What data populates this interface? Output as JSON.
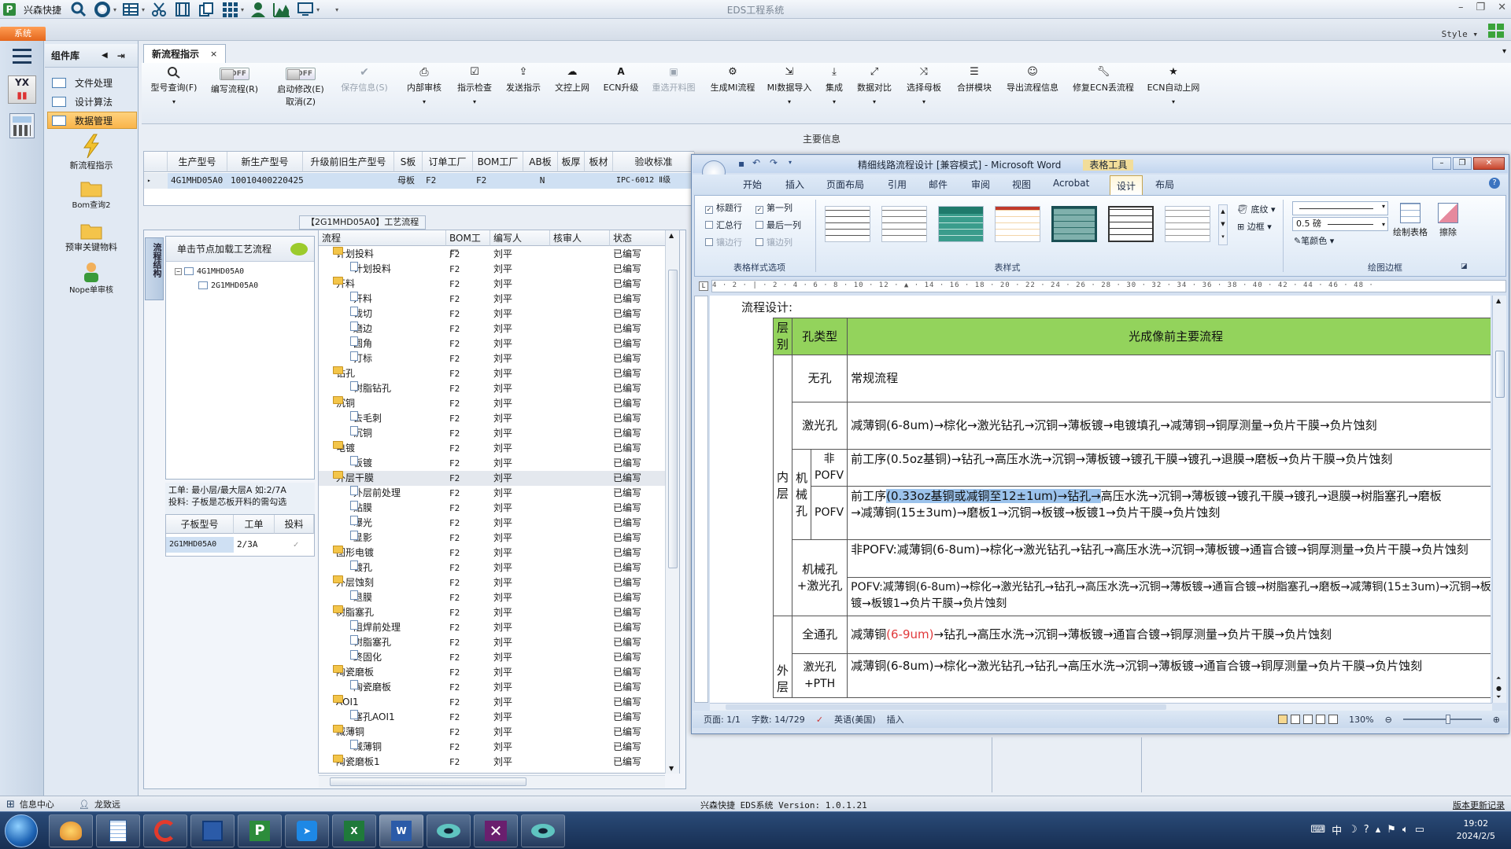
{
  "app": {
    "title": "EDS工程系统",
    "brand": "兴森快捷",
    "style_menu": "Style",
    "system_tab": "系统",
    "accent": "#f47b2a"
  },
  "quick_access": [
    {
      "icon": "search-icon"
    },
    {
      "icon": "lifebuoy-icon"
    },
    {
      "icon": "table-icon"
    },
    {
      "icon": "scissors-icon"
    },
    {
      "icon": "film-icon"
    },
    {
      "icon": "copy-icon"
    },
    {
      "icon": "grid-icon"
    },
    {
      "icon": "user-icon"
    },
    {
      "icon": "area-chart-icon"
    },
    {
      "icon": "monitor-icon"
    }
  ],
  "left_nav": {
    "header": "组件库",
    "items": [
      {
        "label": "文件处理",
        "active": false
      },
      {
        "label": "设计算法",
        "active": false
      },
      {
        "label": "数据管理",
        "active": true
      }
    ],
    "tools": [
      {
        "label": "新流程指示",
        "icon": "lightning-icon"
      },
      {
        "label": "Bom查询2",
        "icon": "folder-icon"
      },
      {
        "label": "预审关键物料",
        "icon": "folder-icon"
      },
      {
        "label": "Nope单审核",
        "icon": "person-icon"
      }
    ]
  },
  "document_tab": {
    "label": "新流程指示"
  },
  "ribbon": [
    {
      "label": "型号查询(F)",
      "icon": "search-icon",
      "disabled": false,
      "dropdown": true
    },
    {
      "label": "编写流程(R)",
      "toggle": "OFF"
    },
    {
      "label": "启动修改(E)",
      "label2": "取消(Z)",
      "toggle": "OFF"
    },
    {
      "label": "保存信息(S)",
      "icon": "check-icon",
      "disabled": true
    },
    {
      "label": "内部审核",
      "icon": "print-icon",
      "dropdown": true
    },
    {
      "label": "指示检查",
      "icon": "checkbox-icon",
      "dropdown": true
    },
    {
      "label": "发送指示",
      "icon": "upload-icon"
    },
    {
      "label": "文控上网",
      "icon": "cloud-upload-icon"
    },
    {
      "label": "ECN升级",
      "icon": "acrobat-icon"
    },
    {
      "label": "重选开料图",
      "icon": "image-icon",
      "disabled": true
    },
    {
      "label": "生成MI流程",
      "icon": "gears-icon"
    },
    {
      "label": "MI数据导入",
      "icon": "import-icon",
      "dropdown": true
    },
    {
      "label": "集成",
      "icon": "download-icon",
      "dropdown": true
    },
    {
      "label": "数据对比",
      "icon": "compare-icon",
      "dropdown": true
    },
    {
      "label": "选择母板",
      "icon": "shuffle-icon",
      "dropdown": true
    },
    {
      "label": "合拼模块",
      "icon": "list-icon"
    },
    {
      "label": "导出流程信息",
      "icon": "smile-icon"
    },
    {
      "label": "修复ECN丢流程",
      "icon": "wrench-icon"
    },
    {
      "label": "ECN自动上网",
      "icon": "star-icon",
      "dropdown": true
    }
  ],
  "main_info": {
    "label": "主要信息",
    "columns": [
      "生产型号",
      "新生产型号",
      "升级前旧生产型号",
      "S板",
      "订单工厂",
      "BOM工厂",
      "AB板",
      "板厚",
      "板材",
      "验收标准"
    ],
    "row": [
      "4G1MHD05A0",
      "10010400220425",
      "",
      "母板",
      "F2",
      "F2",
      "N",
      "",
      "",
      "IPC-6012 Ⅱ级"
    ]
  },
  "workflow_panel": {
    "title": "【2G1MHD05A0】工艺流程",
    "side_tab": "流程结构",
    "tree_header": "单击节点加载工艺流程",
    "tree": [
      {
        "label": "4G1MHD05A0",
        "level": 0
      },
      {
        "label": "2G1MHD05A0",
        "level": 1
      }
    ],
    "layer_info": "工单: 最小层/最大层A 如:2/7A\n投料: 子板是芯板开料的需勾选",
    "sub_columns": [
      "子板型号",
      "工单",
      "投料"
    ],
    "sub_row": [
      "2G1MHD05A0",
      "2/3A",
      "✓"
    ]
  },
  "process_grid": {
    "columns": [
      "流程",
      "BOM工厂",
      "编写人",
      "核审人",
      "状态"
    ],
    "rows": [
      {
        "name": "计划投料",
        "level": 0,
        "folder": true,
        "factory": "F2",
        "writer": "刘平",
        "status": "已编写"
      },
      {
        "name": "计划投料",
        "level": 1,
        "folder": false,
        "factory": "F2",
        "writer": "刘平",
        "status": "已编写"
      },
      {
        "name": "开料",
        "level": 0,
        "folder": true,
        "factory": "F2",
        "writer": "刘平",
        "status": "已编写"
      },
      {
        "name": "开料",
        "level": 1,
        "folder": false,
        "factory": "F2",
        "writer": "刘平",
        "status": "已编写"
      },
      {
        "name": "裁切",
        "level": 1,
        "folder": false,
        "factory": "F2",
        "writer": "刘平",
        "status": "已编写"
      },
      {
        "name": "磨边",
        "level": 1,
        "folder": false,
        "factory": "F2",
        "writer": "刘平",
        "status": "已编写"
      },
      {
        "name": "圆角",
        "level": 1,
        "folder": false,
        "factory": "F2",
        "writer": "刘平",
        "status": "已编写"
      },
      {
        "name": "打标",
        "level": 1,
        "folder": false,
        "factory": "F2",
        "writer": "刘平",
        "status": "已编写"
      },
      {
        "name": "钻孔",
        "level": 0,
        "folder": true,
        "factory": "F2",
        "writer": "刘平",
        "status": "已编写"
      },
      {
        "name": "树脂钻孔",
        "level": 1,
        "folder": false,
        "factory": "F2",
        "writer": "刘平",
        "status": "已编写"
      },
      {
        "name": "沉铜",
        "level": 0,
        "folder": true,
        "factory": "F2",
        "writer": "刘平",
        "status": "已编写"
      },
      {
        "name": "去毛刺",
        "level": 1,
        "folder": false,
        "factory": "F2",
        "writer": "刘平",
        "status": "已编写"
      },
      {
        "name": "沉铜",
        "level": 1,
        "folder": false,
        "factory": "F2",
        "writer": "刘平",
        "status": "已编写"
      },
      {
        "name": "电镀",
        "level": 0,
        "folder": true,
        "factory": "F2",
        "writer": "刘平",
        "status": "已编写"
      },
      {
        "name": "板镀",
        "level": 1,
        "folder": false,
        "factory": "F2",
        "writer": "刘平",
        "status": "已编写"
      },
      {
        "name": "外层干膜",
        "level": 0,
        "folder": true,
        "factory": "F2",
        "writer": "刘平",
        "status": "已编写",
        "hover": true
      },
      {
        "name": "外层前处理",
        "level": 1,
        "folder": false,
        "factory": "F2",
        "writer": "刘平",
        "status": "已编写"
      },
      {
        "name": "贴膜",
        "level": 1,
        "folder": false,
        "factory": "F2",
        "writer": "刘平",
        "status": "已编写"
      },
      {
        "name": "曝光",
        "level": 1,
        "folder": false,
        "factory": "F2",
        "writer": "刘平",
        "status": "已编写"
      },
      {
        "name": "显影",
        "level": 1,
        "folder": false,
        "factory": "F2",
        "writer": "刘平",
        "status": "已编写"
      },
      {
        "name": "图形电镀",
        "level": 0,
        "folder": true,
        "factory": "F2",
        "writer": "刘平",
        "status": "已编写"
      },
      {
        "name": "镀孔",
        "level": 1,
        "folder": false,
        "factory": "F2",
        "writer": "刘平",
        "status": "已编写"
      },
      {
        "name": "外层蚀刻",
        "level": 0,
        "folder": true,
        "factory": "F2",
        "writer": "刘平",
        "status": "已编写"
      },
      {
        "name": "退膜",
        "level": 1,
        "folder": false,
        "factory": "F2",
        "writer": "刘平",
        "status": "已编写"
      },
      {
        "name": "树脂塞孔",
        "level": 0,
        "folder": true,
        "factory": "F2",
        "writer": "刘平",
        "status": "已编写"
      },
      {
        "name": "阻焊前处理",
        "level": 1,
        "folder": false,
        "factory": "F2",
        "writer": "刘平",
        "status": "已编写"
      },
      {
        "name": "树脂塞孔",
        "level": 1,
        "folder": false,
        "factory": "F2",
        "writer": "刘平",
        "status": "已编写"
      },
      {
        "name": "终固化",
        "level": 1,
        "folder": false,
        "factory": "F2",
        "writer": "刘平",
        "status": "已编写"
      },
      {
        "name": "陶瓷磨板",
        "level": 0,
        "folder": true,
        "factory": "F2",
        "writer": "刘平",
        "status": "已编写"
      },
      {
        "name": "陶瓷磨板",
        "level": 1,
        "folder": false,
        "factory": "F2",
        "writer": "刘平",
        "status": "已编写"
      },
      {
        "name": "AOI1",
        "level": 0,
        "folder": true,
        "factory": "F2",
        "writer": "刘平",
        "status": "已编写"
      },
      {
        "name": "塞孔AOI1",
        "level": 1,
        "folder": false,
        "factory": "F2",
        "writer": "刘平",
        "status": "已编写"
      },
      {
        "name": "减薄铜",
        "level": 0,
        "folder": true,
        "factory": "F2",
        "writer": "刘平",
        "status": "已编写"
      },
      {
        "name": "减薄铜",
        "level": 1,
        "folder": false,
        "factory": "F2",
        "writer": "刘平",
        "status": "已编写"
      },
      {
        "name": "陶瓷磨板1",
        "level": 0,
        "folder": true,
        "factory": "F2",
        "writer": "刘平",
        "status": "已编写"
      }
    ]
  },
  "word": {
    "title": "精细线路流程设计 [兼容模式] - Microsoft Word",
    "context_tab": "表格工具",
    "tabs": [
      "开始",
      "插入",
      "页面布局",
      "引用",
      "邮件",
      "审阅",
      "视图",
      "Acrobat",
      "设计",
      "布局"
    ],
    "active_tab": "设计",
    "style_options": {
      "group_label": "表格样式选项",
      "items": [
        {
          "label": "标题行",
          "checked": true,
          "disabled": false
        },
        {
          "label": "第一列",
          "checked": true,
          "disabled": false
        },
        {
          "label": "汇总行",
          "checked": false,
          "disabled": false
        },
        {
          "label": "最后一列",
          "checked": false,
          "disabled": false
        },
        {
          "label": "镶边行",
          "checked": false,
          "disabled": true
        },
        {
          "label": "镶边列",
          "checked": false,
          "disabled": true
        }
      ]
    },
    "table_styles_label": "表样式",
    "shading_label": "底纹",
    "borders_label": "边框",
    "draw_borders_label": "绘图边框",
    "pen_weight": "0.5 磅",
    "pen_color_label": "笔颜色",
    "draw_table_label": "绘制表格",
    "eraser_label": "擦除",
    "ruler_text": "4 · 2 · | · 2 · 4 · 6 · 8 · 10 · 12 · ▲ · 14 · 16 · 18 · 20 · 22 · 24 · 26 · 28 · 30 · 32 · 34 · 36 · 38 · 40 · 42 · 44 · 46 · 48 ·",
    "doc": {
      "heading": "流程设计:",
      "col_headers": [
        "层别",
        "孔类型",
        "光成像前主要流程"
      ],
      "layer_inner": "内层",
      "layer_outer": "外层",
      "r1_type": "无孔",
      "r1_flow": "常规流程",
      "r2_type": "激光孔",
      "r2_flow": "减薄铜(6-8um)→棕化→激光钻孔→沉铜→薄板镀→电镀填孔→减薄铜→铜厚测量→负片干膜→负片蚀刻",
      "r3_type": "机械孔",
      "r3a_sub": "非POFV",
      "r3a_flow": "前工序(0.5oz基铜)→钻孔→高压水洗→沉铜→薄板镀→镀孔干膜→镀孔→退膜→磨板→负片干膜→负片蚀刻",
      "r3b_sub": "POFV",
      "r3b_prefix": "前工序",
      "r3b_selected": "(0.33oz基铜或减铜至12±1um)→钻孔→",
      "r3b_flow": "高压水洗→沉铜→薄板镀→镀孔干膜→镀孔→退膜→树脂塞孔→磨板→减薄铜(15±3um)→磨板1→沉铜→板镀→板镀1→负片干膜→负片蚀刻",
      "r4_type": "机械孔+激光孔",
      "r4a_flow": "非POFV:减薄铜(6-8um)→棕化→激光钻孔→钻孔→高压水洗→沉铜→薄板镀→通盲合镀→铜厚测量→负片干膜→负片蚀刻",
      "r4b_flow": "POFV:减薄铜(6-8um)→棕化→激光钻孔→钻孔→高压水洗→沉铜→薄板镀→通盲合镀→树脂塞孔→磨板→减薄铜(15±3um)→沉铜→板镀→板镀1→负片干膜→负片蚀刻",
      "r5_type": "全通孔",
      "r5_prefix": "减薄铜",
      "r5_red": "(6-9um)",
      "r5_flow": "→钻孔→高压水洗→沉铜→薄板镀→通盲合镀→铜厚测量→负片干膜→负片蚀刻",
      "r6_type": "激光孔+PTH",
      "r6_flow": "减薄铜(6-8um)→棕化→激光钻孔→钻孔→高压水洗→沉铜→薄板镀→通盲合镀→铜厚测量→负片干膜→负片蚀刻"
    },
    "status": {
      "page": "页面: 1/1",
      "words": "字数: 14/729",
      "lang": "英语(美国)",
      "mode": "插入",
      "zoom": "130%"
    }
  },
  "status_bar": {
    "info_center": "信息中心",
    "user": "龙致远",
    "version": "兴森快捷 EDS系统 Version: 1.0.1.21",
    "changelog": "版本更新记录"
  },
  "taskbar": {
    "time": "19:02",
    "date": "2024/2/5",
    "ime": "中"
  }
}
